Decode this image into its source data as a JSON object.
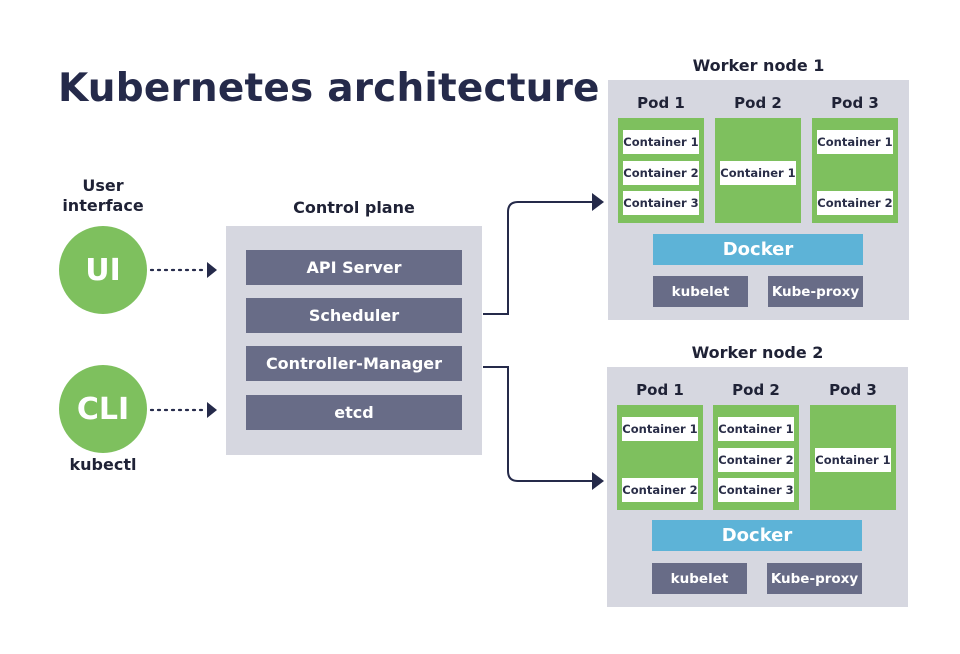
{
  "title": "Kubernetes architecture",
  "clients": {
    "ui": {
      "heading": "User interface",
      "heading_line1": "User",
      "heading_line2": "interface",
      "badge": "UI"
    },
    "cli": {
      "badge": "CLI",
      "caption": "kubectl"
    }
  },
  "control_plane": {
    "heading": "Control plane",
    "components": [
      "API Server",
      "Scheduler",
      "Controller-Manager",
      "etcd"
    ]
  },
  "worker_nodes": [
    {
      "heading": "Worker node 1",
      "pods": [
        {
          "label": "Pod 1",
          "containers": [
            "Container 1",
            "Container 2",
            "Container 3"
          ]
        },
        {
          "label": "Pod 2",
          "containers": [
            "Container 1"
          ]
        },
        {
          "label": "Pod 3",
          "containers": [
            "Container 1",
            "Container 2"
          ]
        }
      ],
      "runtime": "Docker",
      "agents": [
        "kubelet",
        "Kube-proxy"
      ]
    },
    {
      "heading": "Worker node 2",
      "pods": [
        {
          "label": "Pod 1",
          "containers": [
            "Container 1",
            "Container 2"
          ]
        },
        {
          "label": "Pod 2",
          "containers": [
            "Container 1",
            "Container 2",
            "Container 3"
          ]
        },
        {
          "label": "Pod 3",
          "containers": [
            "Container 1"
          ]
        }
      ],
      "runtime": "Docker",
      "agents": [
        "kubelet",
        "Kube-proxy"
      ]
    }
  ],
  "colors": {
    "green": "#7ec05e",
    "panel": "#d6d7e0",
    "component": "#686c87",
    "docker": "#5db3d7",
    "arrow": "#252a4a"
  }
}
